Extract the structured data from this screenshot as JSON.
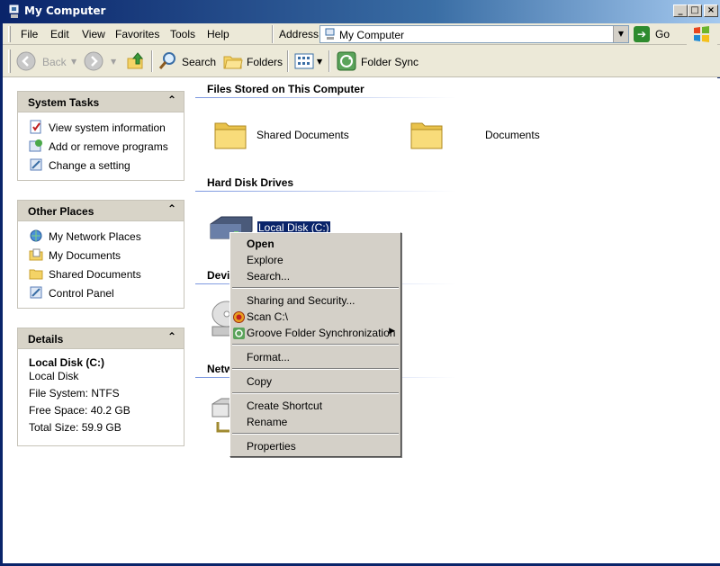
{
  "window": {
    "title": "My Computer"
  },
  "menubar": {
    "items": [
      "File",
      "Edit",
      "View",
      "Favorites",
      "Tools",
      "Help"
    ]
  },
  "address": {
    "label": "Address",
    "value": "My Computer",
    "go_label": "Go"
  },
  "toolbar": {
    "back_label": "Back",
    "search_label": "Search",
    "folders_label": "Folders",
    "folder_sync_label": "Folder Sync"
  },
  "left": {
    "system_tasks": {
      "title": "System Tasks",
      "items": [
        "View system information",
        "Add or remove programs",
        "Change a setting"
      ]
    },
    "other_places": {
      "title": "Other Places",
      "items": [
        "My Network Places",
        "My Documents",
        "Shared Documents",
        "Control Panel"
      ]
    },
    "details": {
      "title": "Details",
      "name": "Local Disk (C:)",
      "type": "Local Disk",
      "file_system": "File System: NTFS",
      "free_space": "Free Space: 40.2 GB",
      "total_size": "Total Size: 59.9 GB"
    }
  },
  "right": {
    "groups": {
      "files_stored": "Files Stored on This Computer",
      "hard_disks": "Hard Disk Drives",
      "devices": "Devi",
      "network": "Netw"
    },
    "files": [
      "Shared Documents",
      "Documents"
    ],
    "disk": "Local Disk (C:)"
  },
  "context_menu": {
    "items": [
      "Open",
      "Explore",
      "Search...",
      "Sharing and Security...",
      "Scan C:\\",
      "Groove Folder Synchronization",
      "Format...",
      "Copy",
      "Create Shortcut",
      "Rename",
      "Properties"
    ]
  },
  "colors": {
    "title_bar": "#0a246a",
    "selection": "#0a246a",
    "panel_header": "#d8d4c8"
  }
}
